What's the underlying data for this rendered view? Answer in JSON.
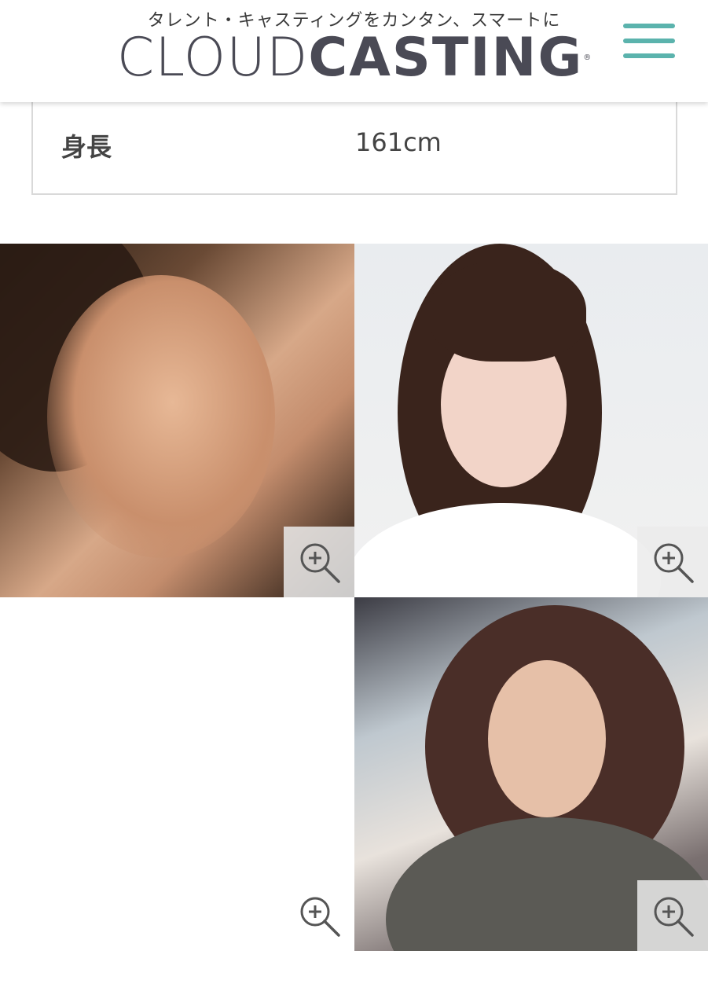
{
  "header": {
    "tagline": "タレント・キャスティングをカンタン、スマートに",
    "logo_light": "CLOUD",
    "logo_bold": "CASTING",
    "logo_mark": "®",
    "menu_icon": "hamburger-menu-icon",
    "accent_color": "#5bb3ad"
  },
  "profile": {
    "rows": [
      {
        "label": "身長",
        "value": "161cm"
      }
    ]
  },
  "gallery": {
    "zoom_icon": "zoom-in-icon",
    "photos": [
      {
        "name": "photo-1"
      },
      {
        "name": "photo-2"
      },
      {
        "name": "photo-3"
      }
    ]
  }
}
